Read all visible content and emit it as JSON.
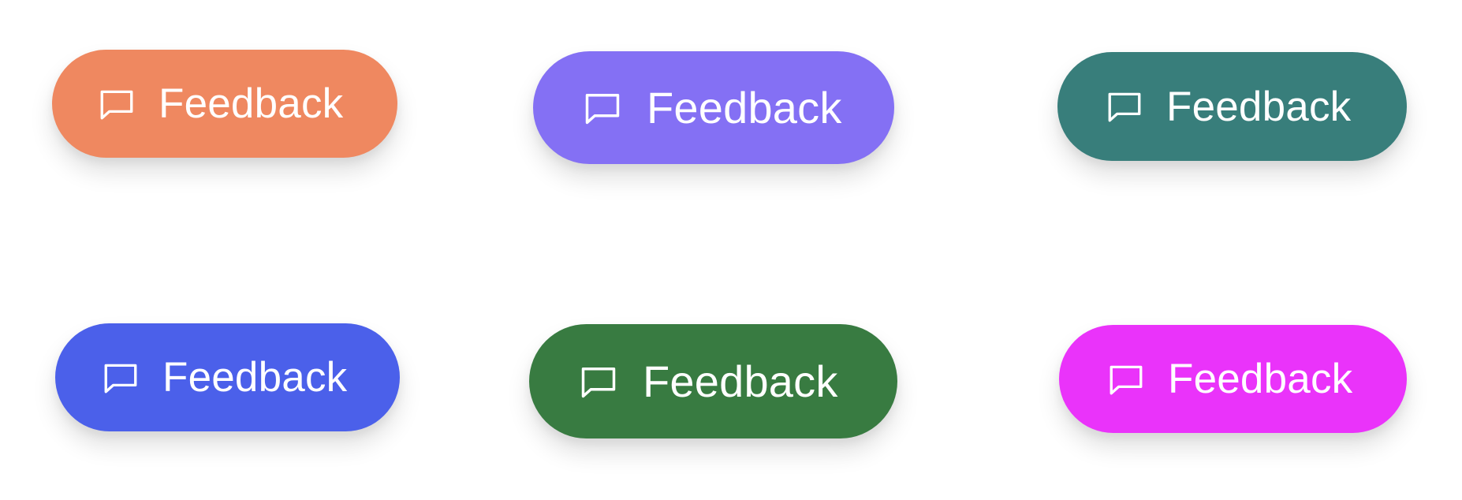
{
  "buttons": [
    {
      "label": "Feedback",
      "icon": "message-square-icon",
      "color": "#EF8860"
    },
    {
      "label": "Feedback",
      "icon": "message-square-icon",
      "color": "#8470F4"
    },
    {
      "label": "Feedback",
      "icon": "message-square-icon",
      "color": "#387E7B"
    },
    {
      "label": "Feedback",
      "icon": "message-square-icon",
      "color": "#4B60EA"
    },
    {
      "label": "Feedback",
      "icon": "message-square-icon",
      "color": "#387B41"
    },
    {
      "label": "Feedback",
      "icon": "message-square-icon",
      "color": "#EA33FA"
    }
  ]
}
